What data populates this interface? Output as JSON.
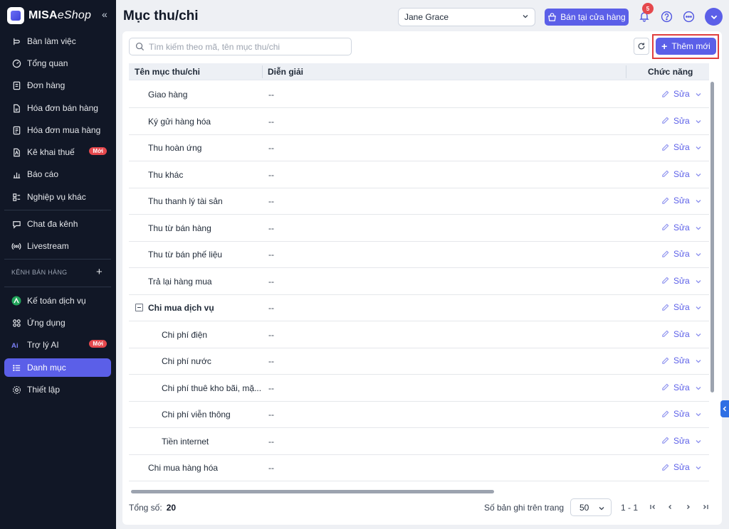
{
  "app": {
    "logo_bold": "MISA",
    "logo_light": "eShop"
  },
  "sidebar": {
    "collapse_glyph": "«",
    "items": [
      {
        "label": "Bàn làm việc",
        "icon": "workspace-icon"
      },
      {
        "label": "Tổng quan",
        "icon": "dashboard-icon"
      },
      {
        "label": "Đơn hàng",
        "icon": "order-icon"
      },
      {
        "label": "Hóa đơn bán hàng",
        "icon": "sales-invoice-icon"
      },
      {
        "label": "Hóa đơn mua hàng",
        "icon": "purchase-invoice-icon"
      },
      {
        "label": "Kê khai thuế",
        "icon": "tax-icon",
        "badge": "Mới"
      },
      {
        "label": "Báo cáo",
        "icon": "report-icon"
      },
      {
        "label": "Nghiệp vụ khác",
        "icon": "operations-icon"
      },
      {
        "label": "Chat đa kênh",
        "icon": "chat-icon"
      },
      {
        "label": "Livestream",
        "icon": "livestream-icon"
      },
      {
        "label": "Kế toán dịch vụ",
        "icon": "accounting-icon"
      },
      {
        "label": "Ứng dụng",
        "icon": "apps-icon"
      },
      {
        "label": "Trợ lý AI",
        "icon": "ai-icon",
        "badge": "Mới"
      },
      {
        "label": "Danh mục",
        "icon": "list-icon",
        "active": true
      },
      {
        "label": "Thiết lập",
        "icon": "settings-icon"
      }
    ],
    "section_label": "KÊNH BÁN HÀNG",
    "section_plus": "+"
  },
  "header": {
    "title": "Mục thu/chi",
    "user_select": "Jane Grace",
    "store_button": "Bán tại cửa hàng",
    "notification_count": "5"
  },
  "toolbar": {
    "search_placeholder": "Tìm kiếm theo mã, tên mục thu/chi",
    "add_button": "Thêm mới",
    "add_plus": "+"
  },
  "table": {
    "columns": [
      "Tên mục thu/chi",
      "Diễn giải",
      "Chức năng"
    ],
    "edit_label": "Sửa",
    "rows": [
      {
        "name": "Giao hàng",
        "desc": "--",
        "level": 1
      },
      {
        "name": "Ký gửi hàng hóa",
        "desc": "--",
        "level": 1
      },
      {
        "name": "Thu hoàn ứng",
        "desc": "--",
        "level": 1
      },
      {
        "name": "Thu khác",
        "desc": "--",
        "level": 1
      },
      {
        "name": "Thu thanh lý tài sản",
        "desc": "--",
        "level": 1
      },
      {
        "name": "Thu từ bán hàng",
        "desc": "--",
        "level": 1
      },
      {
        "name": "Thu từ bán phế liệu",
        "desc": "--",
        "level": 1
      },
      {
        "name": "Trả lại hàng mua",
        "desc": "--",
        "level": 1
      },
      {
        "name": "Chi mua dịch vụ",
        "desc": "--",
        "level": 1,
        "group": true
      },
      {
        "name": "Chi phí điện",
        "desc": "--",
        "level": 2
      },
      {
        "name": "Chi phí nước",
        "desc": "--",
        "level": 2
      },
      {
        "name": "Chi phí thuê kho bãi, mặ...",
        "desc": "--",
        "level": 2
      },
      {
        "name": "Chi phí viễn thông",
        "desc": "--",
        "level": 2
      },
      {
        "name": "Tiền internet",
        "desc": "--",
        "level": 2
      },
      {
        "name": "Chi mua hàng hóa",
        "desc": "--",
        "level": 1
      }
    ]
  },
  "footer": {
    "total_label": "Tổng số:",
    "total_value": "20",
    "per_page_label": "Số bản ghi trên trang",
    "per_page_value": "50",
    "range": "1 - 1"
  },
  "colors": {
    "accent": "#5b5fe8",
    "sidebar_bg": "#111726",
    "badge_red": "#e5484d",
    "highlight_outline": "#e03e3e"
  }
}
